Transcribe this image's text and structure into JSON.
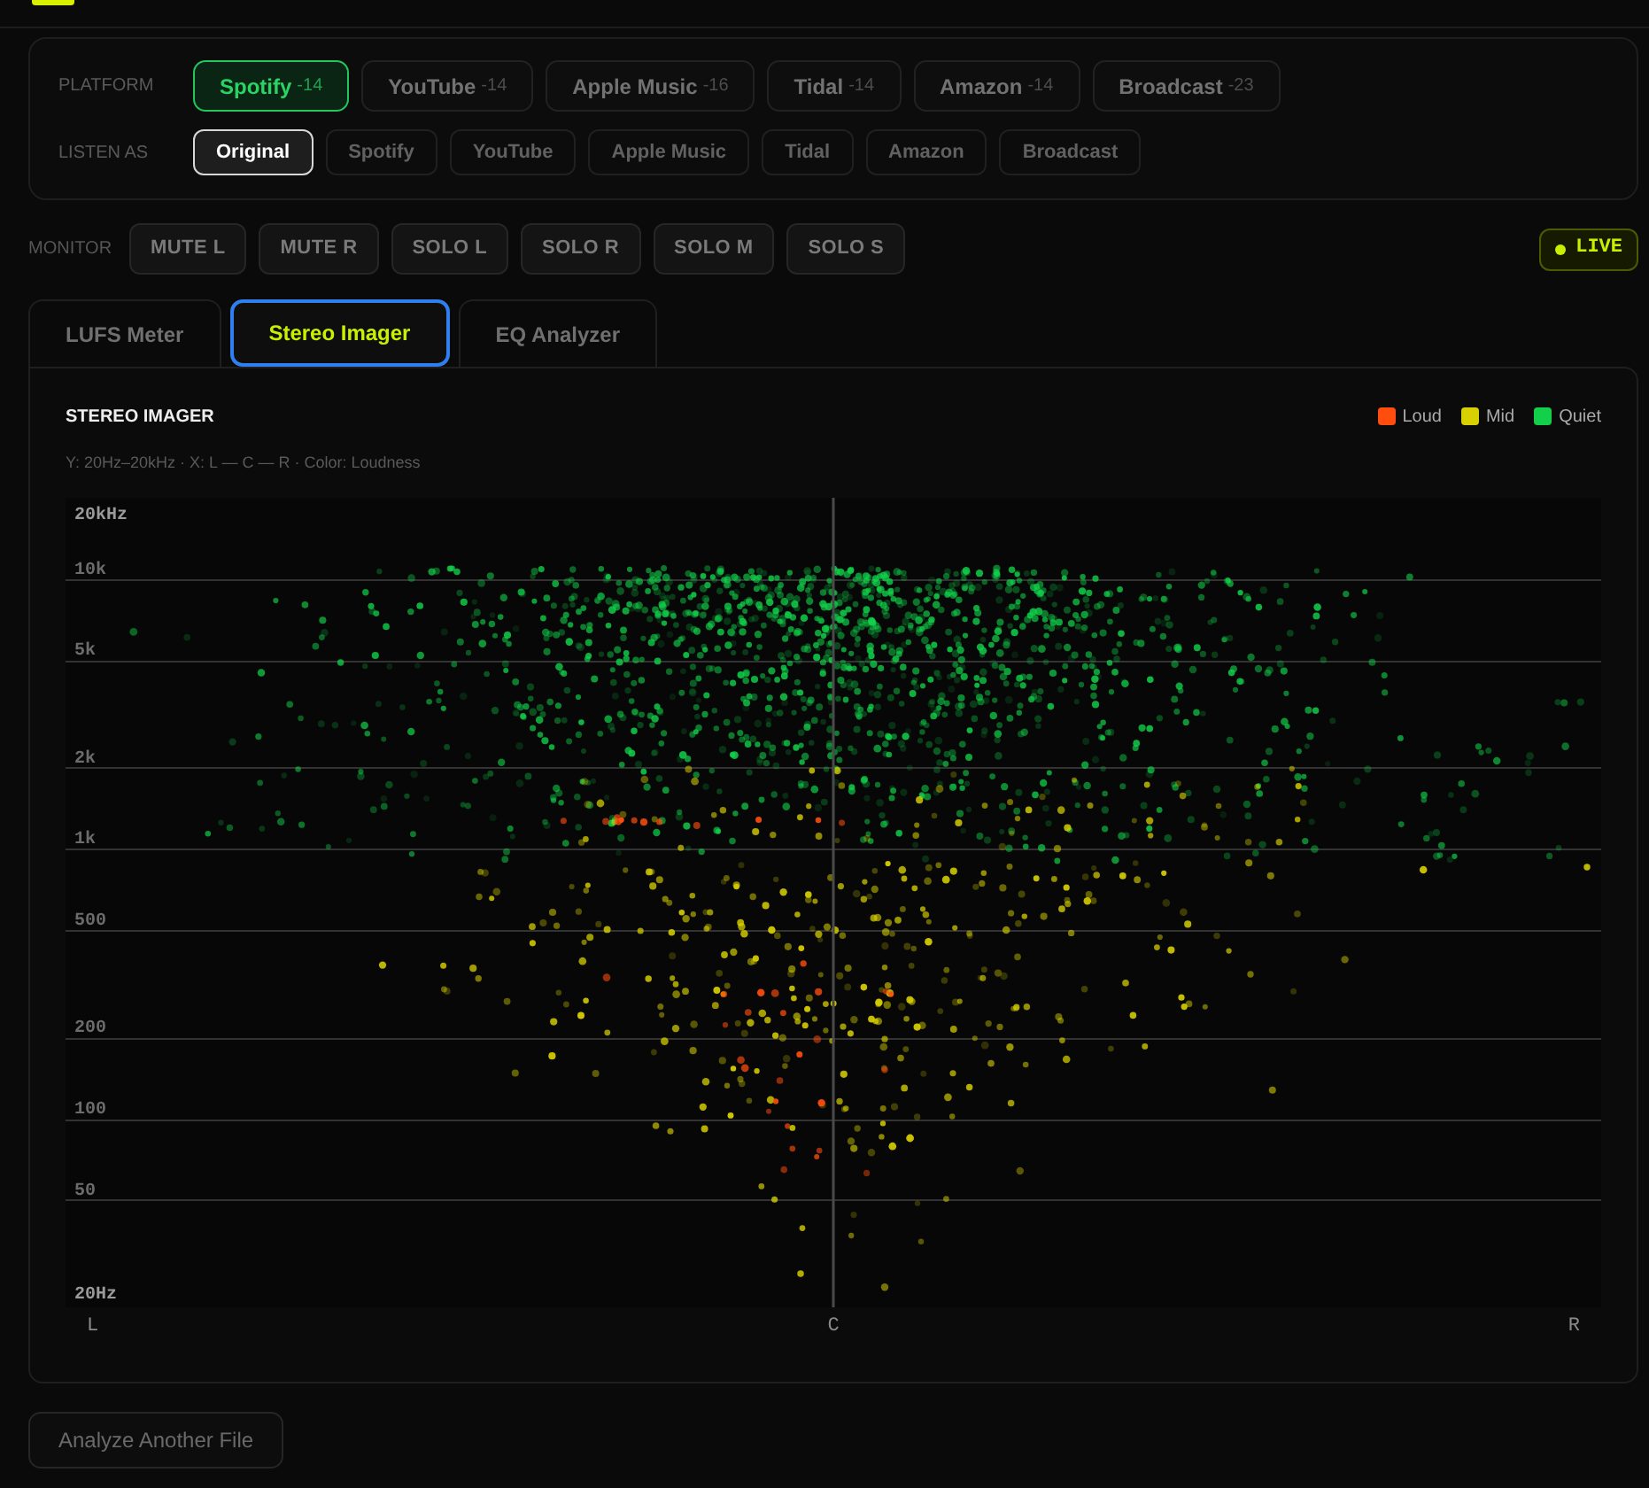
{
  "platform": {
    "label": "PLATFORM",
    "options": [
      {
        "name": "Spotify",
        "target": "-14",
        "selected": true
      },
      {
        "name": "YouTube",
        "target": "-14",
        "selected": false
      },
      {
        "name": "Apple Music",
        "target": "-16",
        "selected": false
      },
      {
        "name": "Tidal",
        "target": "-14",
        "selected": false
      },
      {
        "name": "Amazon",
        "target": "-14",
        "selected": false
      },
      {
        "name": "Broadcast",
        "target": "-23",
        "selected": false
      }
    ]
  },
  "listen_as": {
    "label": "LISTEN AS",
    "options": [
      {
        "name": "Original",
        "selected": true
      },
      {
        "name": "Spotify",
        "selected": false
      },
      {
        "name": "YouTube",
        "selected": false
      },
      {
        "name": "Apple Music",
        "selected": false
      },
      {
        "name": "Tidal",
        "selected": false
      },
      {
        "name": "Amazon",
        "selected": false
      },
      {
        "name": "Broadcast",
        "selected": false
      }
    ]
  },
  "monitor": {
    "label": "MONITOR",
    "buttons": [
      "MUTE L",
      "MUTE R",
      "SOLO L",
      "SOLO R",
      "SOLO M",
      "SOLO S"
    ]
  },
  "live_badge": {
    "label": "LIVE"
  },
  "tabs": [
    {
      "label": "LUFS Meter",
      "selected": false
    },
    {
      "label": "Stereo Imager",
      "selected": true
    },
    {
      "label": "EQ Analyzer",
      "selected": false
    }
  ],
  "stereo_imager": {
    "title": "STEREO IMAGER",
    "subtitle": "Y: 20Hz–20kHz · X: L — C — R · Color: Loudness",
    "legend": [
      {
        "label": "Loud",
        "color": "#ff4d0d"
      },
      {
        "label": "Mid",
        "color": "#d8d000"
      },
      {
        "label": "Quiet",
        "color": "#12d04a"
      }
    ],
    "y_axis_labels": [
      "20kHz",
      "10k",
      "5k",
      "2k",
      "1k",
      "500",
      "200",
      "100",
      "50",
      "20Hz"
    ],
    "x_axis_labels": [
      "L",
      "C",
      "R"
    ]
  },
  "analyze_button": {
    "label": "Analyze Another File"
  }
}
